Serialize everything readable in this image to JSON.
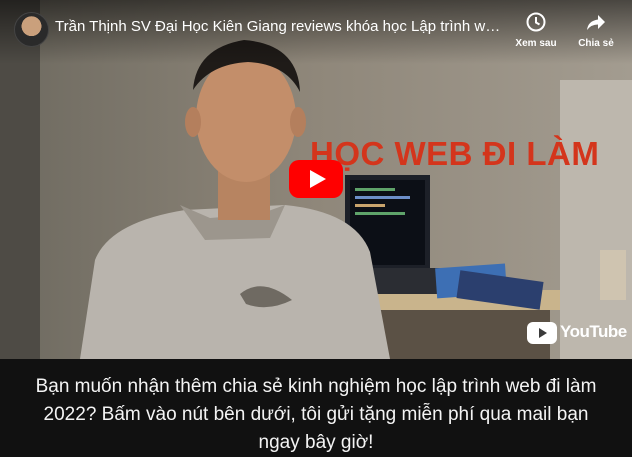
{
  "player": {
    "title": "Trần Thịnh SV Đại Học Kiên Giang reviews khóa học Lập trình web online ...",
    "watch_later_label": "Xem sau",
    "share_label": "Chia sẻ",
    "overlay_text": "HỌC WEB ĐI LÀM",
    "youtube_logo_text": "YouTube",
    "play_button_color": "#ff0000"
  },
  "cta": {
    "message": "Bạn muốn nhận thêm chia sẻ kinh nghiệm học lập trình web đi làm 2022? Bấm vào nút bên dưới, tôi gửi tặng miễn phí qua mail bạn ngay bây giờ!"
  }
}
